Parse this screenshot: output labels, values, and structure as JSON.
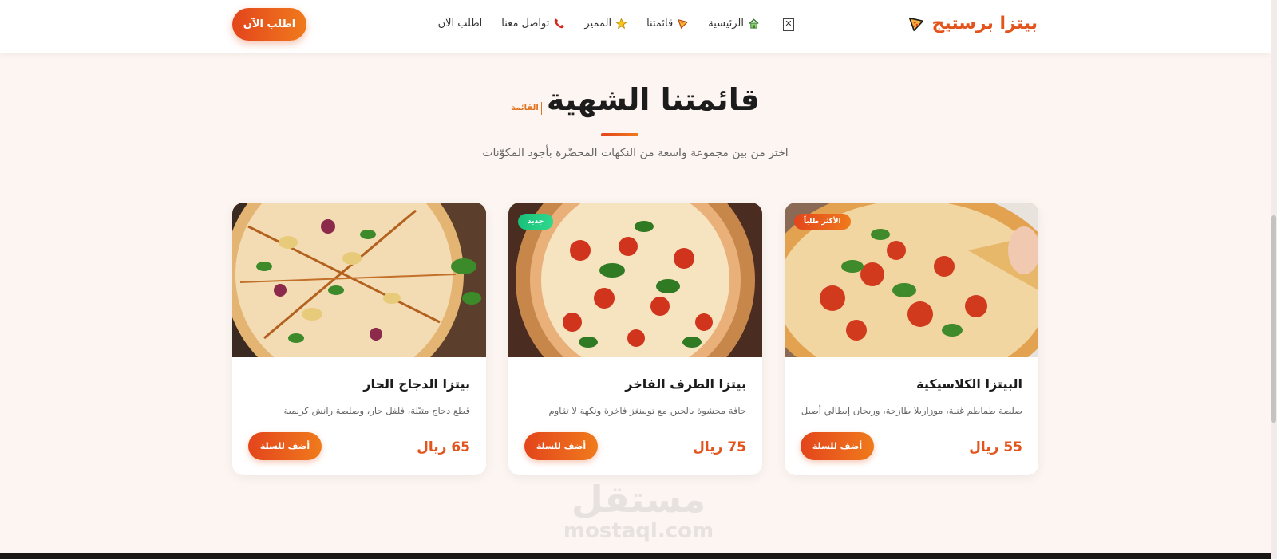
{
  "header": {
    "logo_text": "بيتزا برستيج",
    "logo_icon": "pizza-slice-icon",
    "close_icon_glyph": "✕",
    "nav": [
      {
        "label": "الرئيسية",
        "icon": "home-icon"
      },
      {
        "label": "قائمتنا",
        "icon": "pizza-slice-icon"
      },
      {
        "label": "المميز",
        "icon": "star-icon"
      },
      {
        "label": "تواصل معنا",
        "icon": "phone-icon"
      },
      {
        "label": "اطلب الآن",
        "icon": ""
      }
    ],
    "order_button": "اطلب الآن"
  },
  "section": {
    "tag": "القائمة",
    "title": "قائمتنا الشهية",
    "subtitle": "اختر من بين مجموعة واسعة من النكهات المحضّرة بأجود المكوّنات"
  },
  "cards": [
    {
      "badge": "الأكثر طلباً",
      "name": "البيتزا الكلاسيكية",
      "description": "صلصة طماطم غنية، موزاريلا طازجة، وريحان إيطالي أصيل",
      "price": "55 ريال",
      "button": "أضف للسلة"
    },
    {
      "badge": "جديد",
      "name": "بيتزا الطرف الفاخر",
      "description": "حافة محشوة بالجبن مع توبينغز فاخرة ونكهة لا تقاوم",
      "price": "75 ريال",
      "button": "أضف للسلة"
    },
    {
      "badge": "",
      "name": "بيتزا الدجاج الحار",
      "description": "قطع دجاج متبّلة، فلفل حار، وصلصة رانش كريمية",
      "price": "65 ريال",
      "button": "أضف للسلة"
    }
  ],
  "watermark": {
    "arabic": "مستقل",
    "latin": "mostaql.com"
  },
  "colors": {
    "accent": "#e3541c",
    "accent_light": "#f07a1c",
    "new_badge": "#19c07a",
    "page_bg": "#fcf5f1"
  }
}
